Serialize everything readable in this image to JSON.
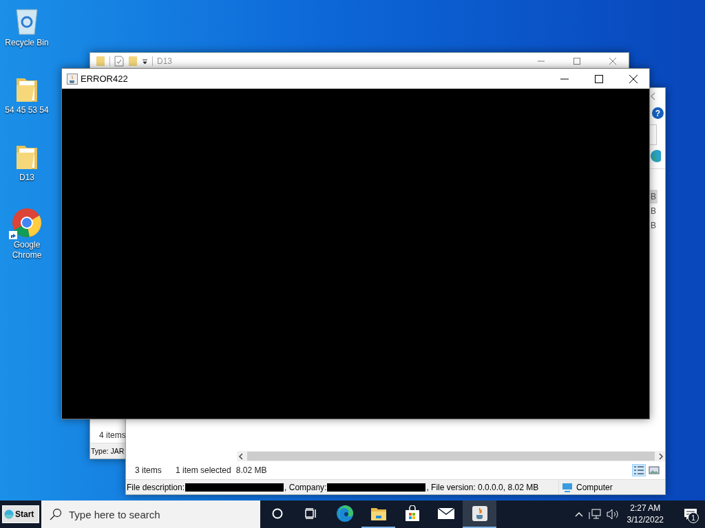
{
  "desktop_icons": [
    {
      "label": "Recycle Bin",
      "kind": "recycle",
      "shortcut": false
    },
    {
      "label": "54 45 53 54",
      "kind": "folder",
      "shortcut": false
    },
    {
      "label": "D13",
      "kind": "folder",
      "shortcut": false
    },
    {
      "label": "Google Chrome",
      "kind": "browser",
      "shortcut": true
    }
  ],
  "back_window": {
    "title": "D13",
    "status": "4 items",
    "details": "Type: JAR"
  },
  "middle_window": {
    "help": "?",
    "rows": [
      {
        "text": "B",
        "selected": true
      },
      {
        "text": "B",
        "selected": false
      },
      {
        "text": "B",
        "selected": false
      }
    ],
    "item_count": "3 items",
    "selection": "1 item selected",
    "selection_size": "8.02 MB",
    "views": [
      {
        "kind": "details",
        "selected": true
      },
      {
        "kind": "tiles",
        "selected": false
      }
    ],
    "details": [
      {
        "kind": "text",
        "text": "File description:"
      },
      {
        "kind": "redacted"
      },
      {
        "kind": "text",
        "text": ", Company:"
      },
      {
        "kind": "redacted"
      },
      {
        "kind": "text",
        "text": ", File version: 0.0.0.0, 8.02 MB"
      }
    ],
    "location": "Computer"
  },
  "front_window": {
    "title": "ERROR422"
  },
  "taskbar": {
    "start": "Start",
    "search_placeholder": "Type here to search",
    "apps": [
      {
        "kind": "cortana",
        "running": false,
        "selected": false
      },
      {
        "kind": "taskview",
        "running": false,
        "selected": false
      },
      {
        "kind": "edge",
        "running": false,
        "selected": false
      },
      {
        "kind": "explorer",
        "running": true,
        "selected": false
      },
      {
        "kind": "store",
        "running": false,
        "selected": false
      },
      {
        "kind": "mail",
        "running": false,
        "selected": false
      },
      {
        "kind": "java",
        "running": true,
        "selected": true
      }
    ],
    "time": "2:27 AM",
    "date": "3/12/2022",
    "notifications": "1"
  }
}
